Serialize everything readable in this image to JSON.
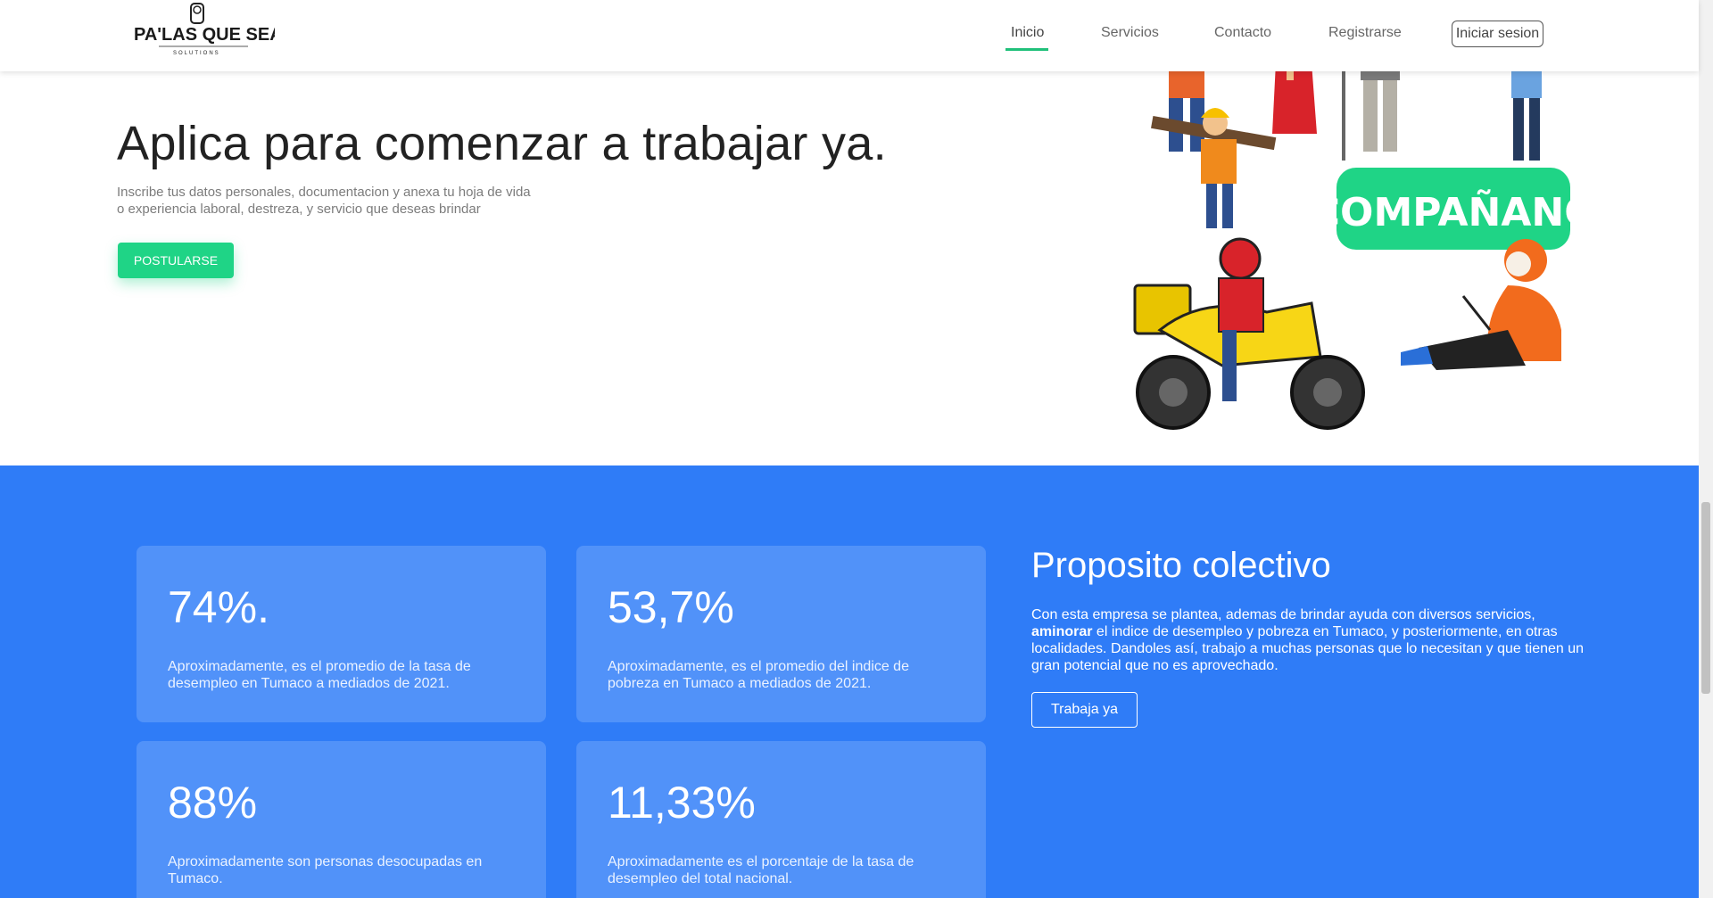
{
  "nav": {
    "logo_text": "PA'LAS QUE SEA",
    "logo_sub": "SOLUTIONS",
    "links": [
      "Inicio",
      "Servicios",
      "Contacto",
      "Registrarse"
    ],
    "login": "Iniciar sesion"
  },
  "hero": {
    "title": "Aplica para comenzar a trabajar ya.",
    "subtitle_line1": "Inscribe tus datos personales, documentacion y anexa tu hoja de vida",
    "subtitle_line2": "o experiencia laboral, destreza, y servicio que deseas brindar",
    "button": "POSTULARSE",
    "banner_text": "ACOMPAÑANOS"
  },
  "stats": [
    {
      "value": "74%.",
      "desc": "Aproximadamente, es el promedio de la tasa de desempleo en Tumaco a mediados de 2021."
    },
    {
      "value": "53,7%",
      "desc": "Aproximadamente, es el promedio del indice de pobreza en Tumaco a mediados de 2021."
    },
    {
      "value": "88%",
      "desc": "Aproximadamente son personas desocupadas en Tumaco."
    },
    {
      "value": "11,33%",
      "desc": "Aproximadamente es el porcentaje de la tasa de desempleo del total nacional."
    }
  ],
  "proposito": {
    "title": "Proposito colectivo",
    "text_before": "Con esta empresa se plantea, ademas de brindar ayuda con diversos servicios, ",
    "text_bold": "aminorar",
    "text_after": " el indice de desempleo y pobreza en Tumaco, y posteriormente, en otras localidades. Dandoles así, trabajo a muchas personas que lo necesitan y que tienen un gran potencial que no es aprovechado.",
    "button": "Trabaja ya"
  },
  "colors": {
    "accent_green": "#1fd486",
    "blue_section": "#2f7cf7",
    "card_blue": "#5192f9"
  }
}
